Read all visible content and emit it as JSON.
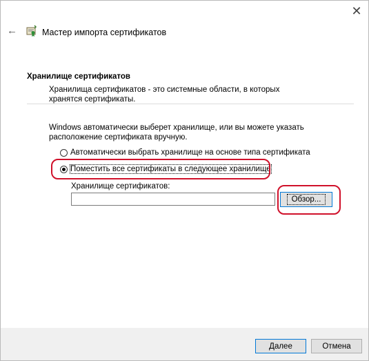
{
  "window": {
    "close_icon": "close-icon"
  },
  "header": {
    "back_icon": "back-arrow-icon",
    "wizard_icon": "certificate-wizard-icon",
    "title": "Мастер импорта сертификатов"
  },
  "section": {
    "title": "Хранилище сертификатов",
    "description": "Хранилища сертификатов - это системные области, в которых хранятся сертификаты."
  },
  "body": {
    "intro": "Windows автоматически выберет хранилище, или вы можете указать расположение сертификата вручную.",
    "options": [
      {
        "label": "Автоматически выбрать хранилище на основе типа сертификата",
        "selected": false
      },
      {
        "label": "Поместить все сертификаты в следующее хранилище",
        "selected": true
      }
    ],
    "store_label": "Хранилище сертификатов:",
    "store_value": "",
    "browse_label": "Обзор..."
  },
  "footer": {
    "next_label": "Далее",
    "cancel_label": "Отмена"
  },
  "highlight_color": "#d0102a"
}
